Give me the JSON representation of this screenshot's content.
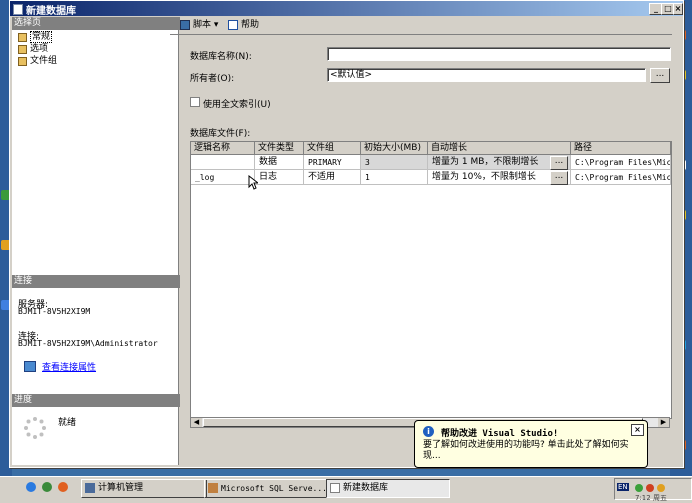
{
  "window": {
    "title": "新建数据库"
  },
  "left_panel": {
    "select_page_header": "选择页",
    "pages": [
      {
        "label": "常规",
        "selected": true
      },
      {
        "label": "选项"
      },
      {
        "label": "文件组"
      }
    ],
    "connection_header": "连接",
    "server_label": "服务器:",
    "server_value": "BJMIT-8V5H2XI9M",
    "connection_label": "连接:",
    "connection_value": "BJMIT-8V5H2XI9M\\Administrator",
    "view_properties_link": "查看连接属性",
    "progress_header": "进度",
    "progress_status": "就绪"
  },
  "toolbar": {
    "script_label": "脚本",
    "help_label": "帮助"
  },
  "form": {
    "db_name_label": "数据库名称(N):",
    "db_name_value": "",
    "owner_label": "所有者(O):",
    "owner_value": "<默认值>",
    "fulltext_label": "使用全文索引(U)",
    "fulltext_checked": false,
    "files_label": "数据库文件(F):",
    "ellipsis": "..."
  },
  "files_table": {
    "columns": [
      "逻辑名称",
      "文件类型",
      "文件组",
      "初始大小(MB)",
      "自动增长",
      "路径"
    ],
    "rows": [
      [
        "",
        "数据",
        "PRIMARY",
        "3",
        "增量为 1 MB，不限制增长",
        "C:\\Program Files\\Micr"
      ],
      [
        "_log",
        "日志",
        "不适用",
        "1",
        "增量为 10%，不限制增长",
        "C:\\Program Files\\Micr"
      ]
    ]
  },
  "balloon": {
    "title": "帮助改进 Visual Studio!",
    "text": "要了解如何改进使用的功能吗? 单击此处了解如何实现..."
  },
  "taskbar": {
    "tasks": [
      "计算机管理",
      "Microsoft SQL Serve...",
      "新建数据库"
    ],
    "ime": "EN",
    "clock": "7:12 周五"
  },
  "colors": {
    "title_start": "#0a246a",
    "title_end": "#a6caf0",
    "section_header": "#808080",
    "balloon_bg": "#ffffe1"
  }
}
